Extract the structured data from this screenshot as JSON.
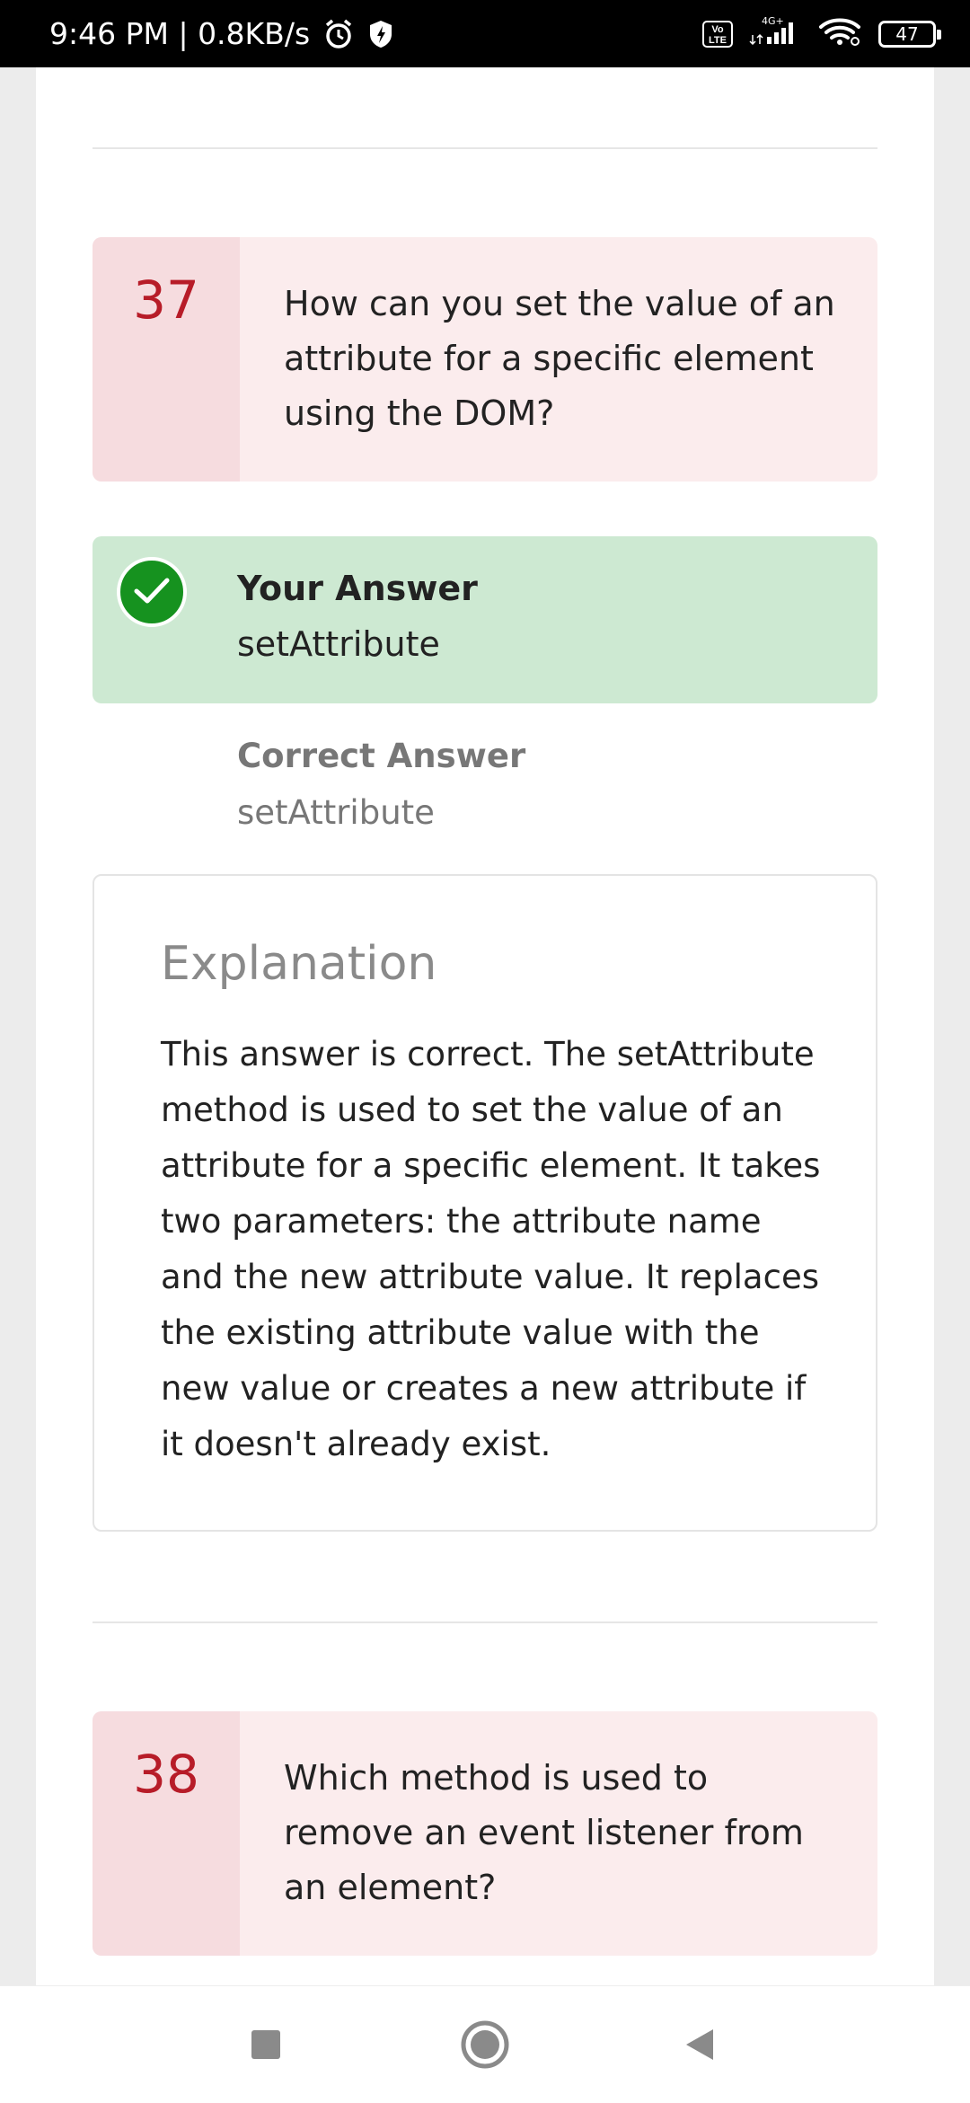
{
  "status_bar": {
    "time_speed": "9:46 PM | 0.8KB/s",
    "icons": [
      "alarm-icon",
      "shield-icon",
      "volte-icon",
      "signal-icon",
      "wifi-icon",
      "battery-icon"
    ],
    "volte_text": "Vo\nLTE",
    "network_label": "4G+",
    "battery_level": "47"
  },
  "questions": [
    {
      "number": "37",
      "text": "How can you set the value of an attribute for a specific element using the DOM?",
      "your_answer_label": "Your Answer",
      "your_answer": "setAttribute",
      "correct_answer_label": "Correct Answer",
      "correct_answer": "setAttribute",
      "explanation_title": "Explanation",
      "explanation": "This answer is correct. The setAttribute method is used to set the value of an attribute for a specific element. It takes two parameters: the attribute name and the new attribute value. It replaces the existing attribute value with the new value or creates a new attribute if it doesn't already exist."
    },
    {
      "number": "38",
      "text": "Which method is used to remove an event listener from an element?"
    }
  ],
  "colors": {
    "question_bg": "#fbeced",
    "question_number_col": "#f6dcdf",
    "question_number": "#b71c28",
    "answer_correct_bg": "#cde9d2",
    "check_green": "#16921f"
  },
  "nav": {
    "buttons": [
      "recents-button",
      "home-button",
      "back-button"
    ]
  }
}
